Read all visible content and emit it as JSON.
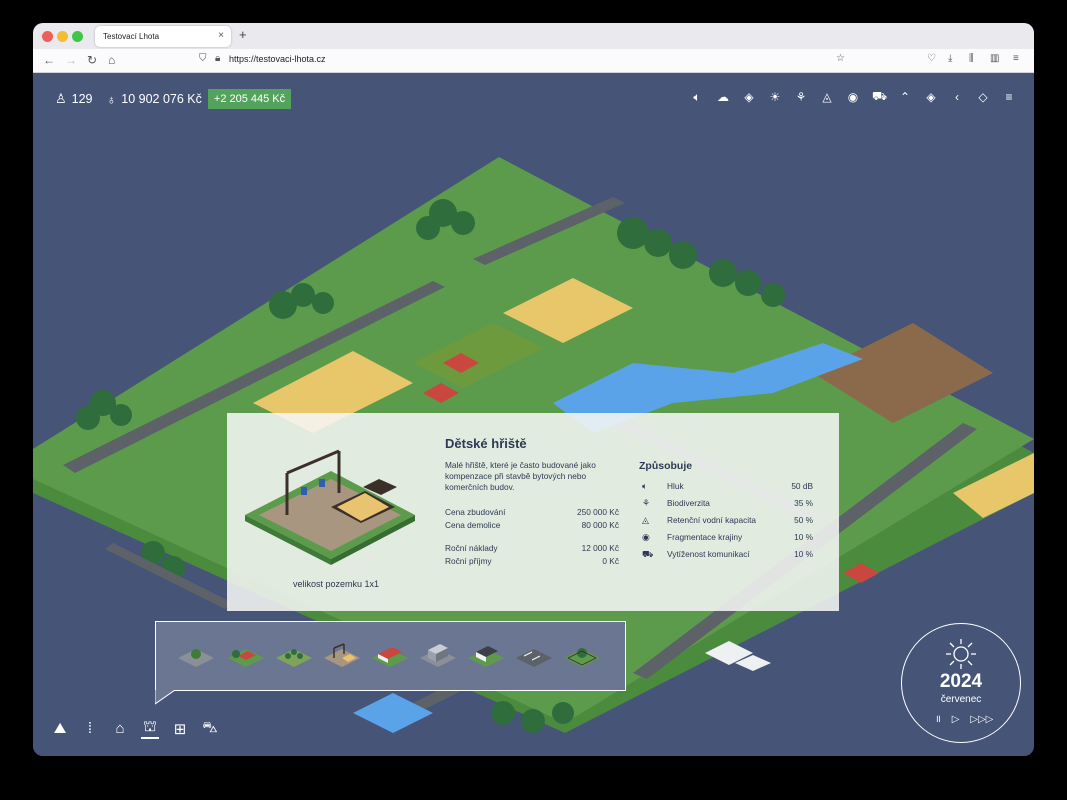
{
  "browser": {
    "tab_title": "Testovací Lhota",
    "tab_close": "×",
    "new_tab": "+",
    "url": "https://testovaci-lhota.cz",
    "traffic_light_colors": [
      "#ee5f57",
      "#f6be2f",
      "#3fc64a"
    ]
  },
  "hud": {
    "population": "129",
    "population_icon": "person-icon",
    "budget": "10 902 076 Kč",
    "budget_icon": "piggy-bank-icon",
    "income": "+2 205 445 Kč",
    "layer_icons": [
      "sound-icon",
      "cloud-icon",
      "layers-icon",
      "sun-icon",
      "biodiversity-icon",
      "water-drop-icon",
      "eye-icon",
      "car-icon",
      "mountain-icon",
      "layers-icon",
      "chevron-left-icon",
      "layers-stack-icon",
      "menu-icon"
    ]
  },
  "info_panel": {
    "title": "Dětské hřiště",
    "description": "Malé hřiště, které je často budované jako kompenzace při stavbě bytových nebo komerčních budov.",
    "plot_size": "velikost pozemku 1x1",
    "costs": [
      {
        "label": "Cena zbudování",
        "value": "250 000 Kč"
      },
      {
        "label": "Cena demolice",
        "value": "80 000 Kč"
      },
      {
        "label": "Roční náklady",
        "value": "12 000 Kč"
      },
      {
        "label": "Roční příjmy",
        "value": "0 Kč"
      }
    ],
    "effects_title": "Způsobuje",
    "effects": [
      {
        "icon": "sound-icon",
        "label": "Hluk",
        "value": "50 dB"
      },
      {
        "icon": "biodiversity-icon",
        "label": "Biodiverzita",
        "value": "35 %"
      },
      {
        "icon": "water-drop-icon",
        "label": "Retenční vodní kapacita",
        "value": "50 %"
      },
      {
        "icon": "eye-icon",
        "label": "Fragmentace krajiny",
        "value": "10 %"
      },
      {
        "icon": "car-icon",
        "label": "Vytíženost komunikací",
        "value": "10 %"
      }
    ]
  },
  "build_menu": {
    "items": [
      "park-building",
      "family-house",
      "garden-plot",
      "playground",
      "red-roof-house",
      "office-building",
      "modern-house",
      "parking-lot",
      "green-park"
    ]
  },
  "bottom_toolbar": {
    "icons": [
      "landscape-icon",
      "road-icon",
      "home-icon",
      "basket-icon",
      "factory-icon",
      "tractor-icon"
    ],
    "active": "basket-icon"
  },
  "clock": {
    "year": "2024",
    "month": "červenec",
    "controls": [
      "pause-icon",
      "play-icon",
      "fast-forward-icon"
    ]
  },
  "colors": {
    "background": "#465477",
    "grass": "#5d9b4c",
    "road": "#5d6168",
    "field": "#e8c66a",
    "water": "#5aa3e8",
    "income_badge": "#53a35c"
  }
}
